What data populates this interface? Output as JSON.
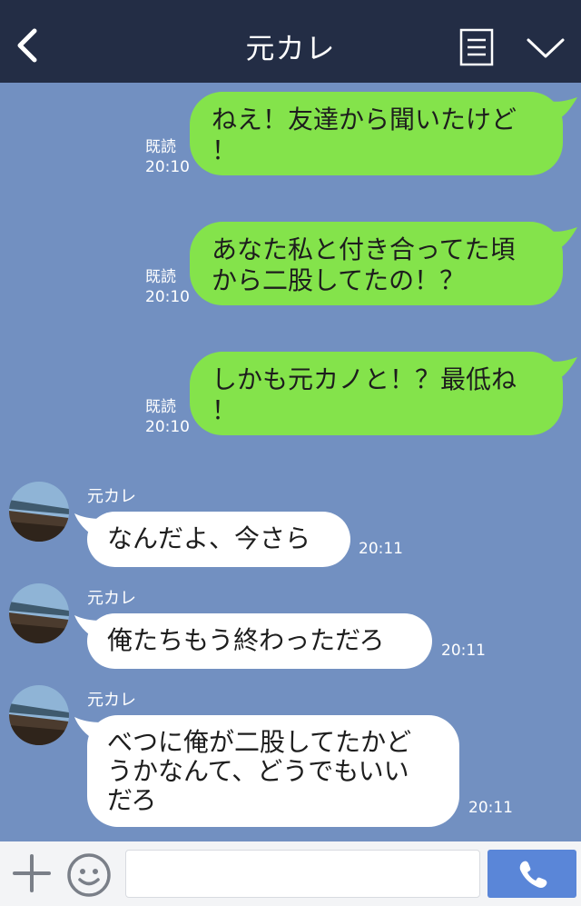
{
  "header": {
    "title": "元カレ",
    "back_icon": "chevron-left-icon",
    "menu_icon": "menu-list-icon",
    "collapse_icon": "chevron-down-icon"
  },
  "messages": [
    {
      "side": "out",
      "read": "既読",
      "time": "20:10",
      "lines": [
        "ねえ！友達から聞いたけど",
        "！"
      ]
    },
    {
      "side": "out",
      "read": "既読",
      "time": "20:10",
      "lines": [
        "あなた私と付き合ってた頃",
        "から二股してたの！？"
      ]
    },
    {
      "side": "out",
      "read": "既読",
      "time": "20:10",
      "lines": [
        "しかも元カノと！？最低ね",
        "！"
      ]
    },
    {
      "side": "in",
      "sender": "元カレ",
      "time": "20:11",
      "lines": [
        "なんだよ、今さら"
      ]
    },
    {
      "side": "in",
      "sender": "元カレ",
      "time": "20:11",
      "lines": [
        "俺たちもう終わっただろ"
      ]
    },
    {
      "side": "in",
      "sender": "元カレ",
      "time": "20:11",
      "lines": [
        "べつに俺が二股してたかど",
        "うかなんて、どうでもいい",
        "だろ"
      ]
    }
  ],
  "footer": {
    "input_placeholder": "",
    "plus_icon": "plus-icon",
    "emoji_icon": "smiley-icon",
    "call_icon": "phone-icon"
  },
  "colors": {
    "header_bg": "#232d45",
    "chat_bg": "#7290c1",
    "outgoing_bubble": "#84e34b",
    "incoming_bubble": "#ffffff",
    "send_button": "#5a86d8"
  }
}
